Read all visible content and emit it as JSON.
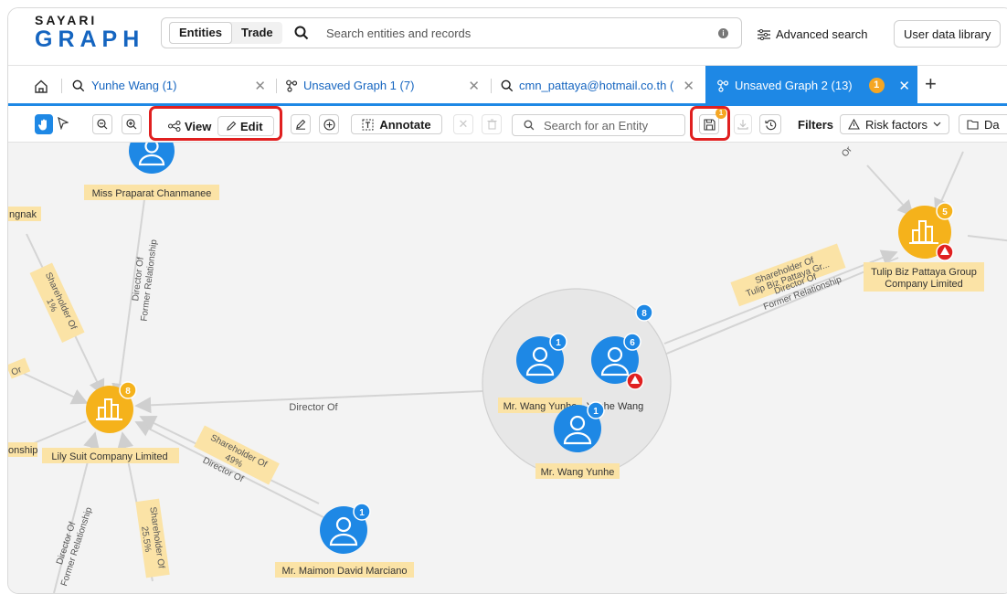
{
  "header": {
    "logo_top": "SAYARI",
    "logo_bottom": "GRAPH",
    "search_modes": [
      "Entities",
      "Trade"
    ],
    "search_placeholder": "Search entities and records",
    "advanced_search": "Advanced search",
    "user_data_library": "User data library"
  },
  "tabs": [
    {
      "label": "Yunhe Wang (1)",
      "icon": "search-icon"
    },
    {
      "label": "Unsaved Graph 1 (7)",
      "icon": "graph-icon"
    },
    {
      "label": "cmn_pattaya@hotmail.co.th (",
      "icon": "search-icon"
    },
    {
      "label": "Unsaved Graph 2 (13)",
      "icon": "graph-icon",
      "badge": "1",
      "active": true
    }
  ],
  "toolbar": {
    "view_label": "View",
    "edit_label": "Edit",
    "annotate_label": "Annotate",
    "search_placeholder": "Search for an Entity",
    "save_badge": "1",
    "filters_label": "Filters",
    "risk_factors_label": "Risk factors",
    "truncated_label": "Da"
  },
  "graph": {
    "nodes": [
      {
        "name": "Miss Praparat Chanmanee",
        "type": "person"
      },
      {
        "name": "Lily Suit Company Limited",
        "type": "company",
        "badge": "8"
      },
      {
        "name": "Tulip Biz Pattaya Group Company Limited",
        "type": "company",
        "badge": "5",
        "risk": true
      },
      {
        "name": "Mr. Wang Yunhe",
        "type": "person",
        "badge": "1"
      },
      {
        "name": "Yunhe Wang",
        "type": "person",
        "badge": "6",
        "risk": true
      },
      {
        "name": "Mr. Wang Yunhe",
        "type": "person",
        "badge": "1"
      },
      {
        "name": "Mr. Maimon David Marciano",
        "type": "person",
        "badge": "1"
      }
    ],
    "cluster_badge": "8",
    "partial_labels": [
      "ngnak",
      "onship"
    ],
    "edge_labels": [
      "Director Of",
      "Shareholder Of",
      "Tulip Biz Pattaya Gr...",
      "Director Of",
      "Former Relationship",
      "Shareholder Of",
      "1%",
      "Director Of",
      "Former Relationship",
      "Or",
      "Shareholder Of",
      "49%",
      "Director Of",
      "Director Of",
      "Former Relationship",
      "Shareholder Of",
      "25.5%",
      "Or"
    ]
  }
}
